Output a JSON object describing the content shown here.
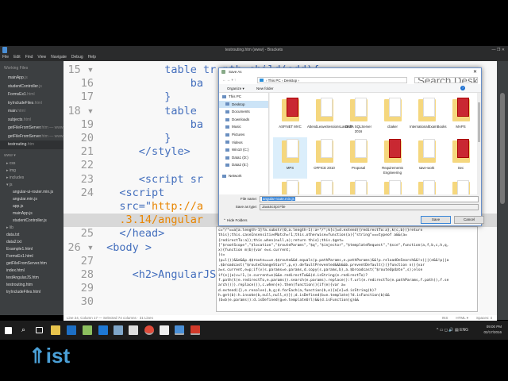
{
  "window": {
    "title": "testrouting.htm (www) - Brackets",
    "controls": "—  ❐  ✕"
  },
  "menu": [
    "File",
    "Edit",
    "Find",
    "View",
    "Navigate",
    "Debug",
    "Help"
  ],
  "sidebar": {
    "working_files_label": "Working Files",
    "working_files": [
      {
        "name": "mainApp",
        "ext": ".js"
      },
      {
        "name": "studentController",
        "ext": ".js"
      },
      {
        "name": "FormsEx1",
        "ext": ".html"
      },
      {
        "name": "tryIncludeFiles",
        "ext": ".html"
      },
      {
        "name": "main",
        "ext": ".html"
      },
      {
        "name": "subjects",
        "ext": ".html"
      },
      {
        "name": "getFileFromServer",
        "ext": ".htm — www"
      },
      {
        "name": "getFileFromServer",
        "ext": ".htm — www"
      },
      {
        "name": "testrouting",
        "ext": ".htm"
      }
    ],
    "project": "www ▾",
    "tree": [
      {
        "label": "▸ css",
        "depth": 1,
        "fold": true
      },
      {
        "label": "▸ img",
        "depth": 1,
        "fold": true
      },
      {
        "label": "▸ includes",
        "depth": 1,
        "fold": true
      },
      {
        "label": "▾ js",
        "depth": 1,
        "fold": true
      },
      {
        "label": "angular-ui-router.min.js",
        "depth": 2
      },
      {
        "label": "angular.min.js",
        "depth": 2
      },
      {
        "label": "app.js",
        "depth": 2
      },
      {
        "label": "mainApp.js",
        "depth": 2
      },
      {
        "label": "studentController.js",
        "depth": 2
      },
      {
        "label": "▸ lib",
        "depth": 1,
        "fold": true
      },
      {
        "label": "data.txt",
        "depth": 1
      },
      {
        "label": "data2.txt",
        "depth": 1
      },
      {
        "label": "Example1.html",
        "depth": 1
      },
      {
        "label": "FormsEx1.html",
        "depth": 1
      },
      {
        "label": "getFileFromServer.htm",
        "depth": 1
      },
      {
        "label": "index.html",
        "depth": 1
      },
      {
        "label": "testAngularJS.htm",
        "depth": 1
      },
      {
        "label": "testrouting.htm",
        "depth": 1
      },
      {
        "label": "tryIncludeFiles.html",
        "depth": 1
      }
    ],
    "logo": "ist"
  },
  "editor": {
    "lines": [
      {
        "n": "15 ▾",
        "code": "          table tr:nth-child(odd){"
      },
      {
        "n": "16",
        "code": "              ba"
      },
      {
        "n": "17",
        "code": "          }"
      },
      {
        "n": "18 ▾",
        "code": "          table"
      },
      {
        "n": "19",
        "code": "              ba"
      },
      {
        "n": "20",
        "code": "          }"
      },
      {
        "n": "21",
        "code": "      </style>"
      },
      {
        "n": "22",
        "code": ""
      },
      {
        "n": "23",
        "code": "      <script sr"
      },
      {
        "n": "24",
        "code": "   <script"
      },
      {
        "n": "",
        "code": "   src=\"",
        "str": "http://a"
      },
      {
        "n": "",
        "code": "",
        "str": "   .3.14/angular"
      },
      {
        "n": "25",
        "code": "   </head>"
      },
      {
        "n": "26 ▾",
        "code": " <body >"
      },
      {
        "n": "27",
        "code": ""
      },
      {
        "n": "28",
        "code": "     <h2>AngularJS"
      },
      {
        "n": "29",
        "code": ""
      },
      {
        "n": "30",
        "code": ""
      }
    ]
  },
  "log_text": "c=\"/\"==a[a.length-1]?a.substr(0,a.length-1):a+\"/\";k[c]=d.extend({redirectTo:a},k(c,b))}return\nthis};this.caseInsensitiveMatch=!1;this.otherwise=function(a){\"string\"===typeof a&&(a=\n{redirectTo:a});this.when(null,a);return this};this.$get=\n[\"$rootScope\",\"$location\",\"$routeParams\",\"$q\",\"$injector\",\"$templateRequest\",\"$sce\",function(a,f,b,c,h,q,\nx){function m(b){var e=s.current;\n(s=\n(p=l())&&e&&p.$$route===e.$$route&&d.equals(p.pathParams,e.pathParams)&&!p.reloadOnSearch&&!v)||(e&&!p||a\n.$broadcast(\"$routeChangeStart\",p,e).defaultPrevented&&b&&b.preventDefault())}function n(){var\na=s.current,e=p;if(v)s.params=e.params,d.copy(s.params,b),a.$broadcast(\"$routeUpdate\",s);else\nif(e||a)v=!1,(s.current=e)&&e.redirectTo&&(d.isString(e.redirectTo)?\nf.path(t(e.redirectTo,e.params)).search(e.params).replace():f.url(e.redirectTo(e.pathParams,f.path(),f.se\narch())).replace()),c.when(e).then(function(){if(e){var a=\nd.extend({},e.resolve),b,g;d.forEach(a,function(b,e){a[e]=d.isString(b)?\nh.get(b):h.invoke(b,null,null,e)});d.isDefined(b=e.template)?d.isFunction(b)&&\n(b=b(e.params)):d.isDefined(g=e.templateUrl)&&(d.isFunction(g)&&",
  "dialog": {
    "title": "Save As",
    "close": "✕",
    "nav_arrows": "←  →  ▾  ↑",
    "breadcrumb": "› This PC › Desktop ›",
    "search_placeholder": "Search Desktop",
    "organize": "Organize ▾",
    "new_folder": "New folder",
    "help": "?",
    "nav_items": [
      {
        "label": "This PC",
        "top": true
      },
      {
        "label": "Desktop",
        "selected": true
      },
      {
        "label": "Documents"
      },
      {
        "label": "Downloads"
      },
      {
        "label": "Music"
      },
      {
        "label": "Pictures"
      },
      {
        "label": "Videos"
      },
      {
        "label": "Win10 (C:)"
      },
      {
        "label": "Data1 (D:)"
      },
      {
        "label": "Data2 (E:)"
      },
      {
        "label": "Network",
        "top": true
      }
    ],
    "items": [
      {
        "label": "ASP.NET MVC",
        "kind": "pdf"
      },
      {
        "label": "AttendLeaveSessionsLastEdit",
        "kind": "edge"
      },
      {
        "label": "DATA SQLServer 2016",
        "kind": "doc"
      },
      {
        "label": "cbaker",
        "kind": "doc"
      },
      {
        "label": "InternationalExamBooks",
        "kind": "doc"
      },
      {
        "label": "MAPS",
        "kind": "pdf"
      },
      {
        "label": "MPS",
        "kind": "doc",
        "selected": true
      },
      {
        "label": "OFFICE 2010",
        "kind": "doc"
      },
      {
        "label": "Proposal",
        "kind": "doc"
      },
      {
        "label": "Requirements Engineering",
        "kind": "pdf"
      },
      {
        "label": "save-work",
        "kind": "doc"
      },
      {
        "label": "Sec",
        "kind": "pdf"
      }
    ],
    "file_name_label": "File name:",
    "file_name_value": "angular-route.min.js",
    "save_type_label": "Save as type:",
    "save_type_value": "JavaScript File",
    "hide_folders": "⌃ Hide Folders",
    "save": "Save",
    "cancel": "Cancel"
  },
  "statusbar": {
    "left": "Line 24, Column 17 — Selected 74 columns · 31 Lines",
    "ins": "INS",
    "lang": "HTML ▾",
    "spaces": "Spaces: 4"
  },
  "tray": {
    "time": "09:00 PM",
    "date": "02/17/2016",
    "lang": "ENG",
    "icons": "^ ▭ ◻ 🔊 ▤"
  },
  "colors": {
    "accent": "#3a86d8",
    "code_tag": "#446fbd",
    "code_string": "#e88501",
    "sidebar": "#3c3f41"
  }
}
